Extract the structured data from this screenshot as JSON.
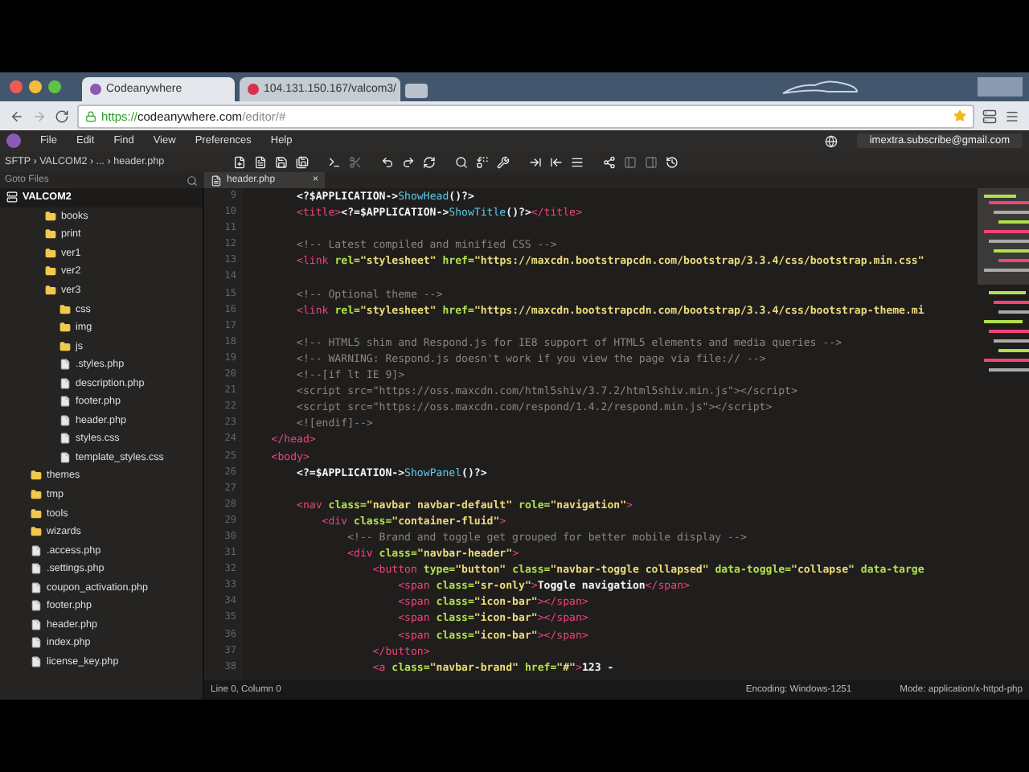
{
  "browser": {
    "tabs": [
      {
        "label": "Codeanywhere",
        "selected": true
      },
      {
        "label": "104.131.150.167/valcom3/",
        "selected": false
      }
    ],
    "address": {
      "scheme": "https://",
      "host": "codeanywhere.com",
      "path": "/editor/#"
    }
  },
  "menu": [
    "File",
    "Edit",
    "Find",
    "View",
    "Preferences",
    "Help"
  ],
  "account": "imextra.subscribe@gmail.com",
  "breadcrumb": "SFTP › VALCOM2 › ... › header.php",
  "goto_files": "Goto Files",
  "open_tab": {
    "label": "header.php",
    "close": "×"
  },
  "tree": {
    "root": "VALCOM2",
    "children": [
      {
        "kind": "folder",
        "children": [
          {
            "kind": "folder",
            "name": "books"
          },
          {
            "kind": "folder",
            "name": "print"
          },
          {
            "kind": "folder",
            "name": "ver1"
          },
          {
            "kind": "folder",
            "name": "ver2"
          },
          {
            "kind": "folder",
            "name": "ver3",
            "children": [
              {
                "kind": "folder",
                "name": "css"
              },
              {
                "kind": "folder",
                "name": "img"
              },
              {
                "kind": "folder",
                "name": "js"
              },
              {
                "kind": "file",
                "name": ".styles.php"
              },
              {
                "kind": "file",
                "name": "description.php"
              },
              {
                "kind": "file",
                "name": "footer.php"
              },
              {
                "kind": "file",
                "name": "header.php"
              },
              {
                "kind": "file",
                "name": "styles.css"
              },
              {
                "kind": "file",
                "name": "template_styles.css"
              }
            ]
          }
        ]
      },
      {
        "kind": "folder",
        "name": "themes"
      },
      {
        "kind": "folder",
        "name": "tmp"
      },
      {
        "kind": "folder",
        "name": "tools"
      },
      {
        "kind": "folder",
        "name": "wizards"
      },
      {
        "kind": "file",
        "name": ".access.php"
      },
      {
        "kind": "file",
        "name": ".settings.php"
      },
      {
        "kind": "file",
        "name": "coupon_activation.php"
      },
      {
        "kind": "file",
        "name": "footer.php"
      },
      {
        "kind": "file",
        "name": "header.php"
      },
      {
        "kind": "file",
        "name": "index.php"
      },
      {
        "kind": "file",
        "name": "license_key.php"
      }
    ]
  },
  "code": [
    {
      "n": "9",
      "tokens": [
        {
          "kind": "php",
          "text": "        <?$APPLICATION->"
        },
        {
          "kind": "method",
          "text": "ShowHead"
        },
        {
          "kind": "php",
          "text": "()?>"
        }
      ]
    },
    {
      "n": "10",
      "tokens": [
        {
          "kind": "tag",
          "text": "        <title>"
        },
        {
          "kind": "php",
          "text": "<?=$APPLICATION->"
        },
        {
          "kind": "method",
          "text": "ShowTitle"
        },
        {
          "kind": "php",
          "text": "()?>"
        },
        {
          "kind": "tag",
          "text": "</title>"
        }
      ]
    },
    {
      "n": "11"
    },
    {
      "n": "12",
      "tokens": [
        {
          "kind": "comment",
          "text": "        <!-- Latest compiled and minified CSS -->"
        }
      ]
    },
    {
      "n": "13",
      "tokens": [
        {
          "kind": "tag",
          "text": "        <link"
        },
        {
          "kind": "attr",
          "text": " rel="
        },
        {
          "kind": "string",
          "text": "\"stylesheet\""
        },
        {
          "kind": "attr",
          "text": " href="
        },
        {
          "kind": "string",
          "text": "\"https://maxcdn.bootstrapcdn.com/bootstrap/3.3.4/css/bootstrap.min.css\""
        }
      ]
    },
    {
      "n": "14"
    },
    {
      "n": "15",
      "tokens": [
        {
          "kind": "comment",
          "text": "        <!-- Optional theme -->"
        }
      ]
    },
    {
      "n": "16",
      "tokens": [
        {
          "kind": "tag",
          "text": "        <link"
        },
        {
          "kind": "attr",
          "text": " rel="
        },
        {
          "kind": "string",
          "text": "\"stylesheet\""
        },
        {
          "kind": "attr",
          "text": " href="
        },
        {
          "kind": "string",
          "text": "\"https://maxcdn.bootstrapcdn.com/bootstrap/3.3.4/css/bootstrap-theme.mi"
        }
      ]
    },
    {
      "n": "17"
    },
    {
      "n": "18",
      "tokens": [
        {
          "kind": "comment",
          "text": "        <!-- HTML5 shim and Respond.js for IE8 support of HTML5 elements and media queries -->"
        }
      ]
    },
    {
      "n": "19",
      "tokens": [
        {
          "kind": "comment",
          "text": "        <!-- WARNING: Respond.js doesn't work if you view the page via file:// -->"
        }
      ]
    },
    {
      "n": "20",
      "tokens": [
        {
          "kind": "comment",
          "text": "        <!--[if lt IE 9]>"
        }
      ]
    },
    {
      "n": "21",
      "tokens": [
        {
          "kind": "comment",
          "text": "        <script src=\"https://oss.maxcdn.com/html5shiv/3.7.2/html5shiv.min.js\"></script>"
        }
      ]
    },
    {
      "n": "22",
      "tokens": [
        {
          "kind": "comment",
          "text": "        <script src=\"https://oss.maxcdn.com/respond/1.4.2/respond.min.js\"></script>"
        }
      ]
    },
    {
      "n": "23",
      "tokens": [
        {
          "kind": "comment",
          "text": "        <![endif]-->"
        }
      ]
    },
    {
      "n": "24",
      "tokens": [
        {
          "kind": "tag",
          "text": "    </head>"
        }
      ]
    },
    {
      "n": "25",
      "tokens": [
        {
          "kind": "tag",
          "text": "    <body>"
        }
      ]
    },
    {
      "n": "26",
      "tokens": [
        {
          "kind": "php",
          "text": "        <?=$APPLICATION->"
        },
        {
          "kind": "method",
          "text": "ShowPanel"
        },
        {
          "kind": "php",
          "text": "()?>"
        }
      ]
    },
    {
      "n": "27"
    },
    {
      "n": "28",
      "tokens": [
        {
          "kind": "tag",
          "text": "        <nav"
        },
        {
          "kind": "attr",
          "text": " class="
        },
        {
          "kind": "string",
          "text": "\"navbar navbar-default\""
        },
        {
          "kind": "attr",
          "text": " role="
        },
        {
          "kind": "string",
          "text": "\"navigation\""
        },
        {
          "kind": "tag",
          "text": ">"
        }
      ]
    },
    {
      "n": "29",
      "tokens": [
        {
          "kind": "tag",
          "text": "            <div"
        },
        {
          "kind": "attr",
          "text": " class="
        },
        {
          "kind": "string",
          "text": "\"container-fluid\""
        },
        {
          "kind": "tag",
          "text": ">"
        }
      ]
    },
    {
      "n": "30",
      "tokens": [
        {
          "kind": "comment",
          "text": "                <!-- Brand and toggle get grouped for better mobile display -->"
        }
      ]
    },
    {
      "n": "31",
      "tokens": [
        {
          "kind": "tag",
          "text": "                <div"
        },
        {
          "kind": "attr",
          "text": " class="
        },
        {
          "kind": "string",
          "text": "\"navbar-header\""
        },
        {
          "kind": "tag",
          "text": ">"
        }
      ]
    },
    {
      "n": "32",
      "tokens": [
        {
          "kind": "tag",
          "text": "                    <button"
        },
        {
          "kind": "attr",
          "text": " type="
        },
        {
          "kind": "string",
          "text": "\"button\""
        },
        {
          "kind": "attr",
          "text": " class="
        },
        {
          "kind": "string",
          "text": "\"navbar-toggle collapsed\""
        },
        {
          "kind": "attr",
          "text": " data-toggle="
        },
        {
          "kind": "string",
          "text": "\"collapse\""
        },
        {
          "kind": "attr",
          "text": " data-targe"
        }
      ]
    },
    {
      "n": "33",
      "tokens": [
        {
          "kind": "tag",
          "text": "                        <span"
        },
        {
          "kind": "attr",
          "text": " class="
        },
        {
          "kind": "string",
          "text": "\"sr-only\""
        },
        {
          "kind": "tag",
          "text": ">"
        },
        {
          "kind": "text",
          "text": "Toggle navigation"
        },
        {
          "kind": "tag",
          "text": "</span>"
        }
      ]
    },
    {
      "n": "34",
      "tokens": [
        {
          "kind": "tag",
          "text": "                        <span"
        },
        {
          "kind": "attr",
          "text": " class="
        },
        {
          "kind": "string",
          "text": "\"icon-bar\""
        },
        {
          "kind": "tag",
          "text": "></span>"
        }
      ]
    },
    {
      "n": "35",
      "tokens": [
        {
          "kind": "tag",
          "text": "                        <span"
        },
        {
          "kind": "attr",
          "text": " class="
        },
        {
          "kind": "string",
          "text": "\"icon-bar\""
        },
        {
          "kind": "tag",
          "text": "></span>"
        }
      ]
    },
    {
      "n": "36",
      "tokens": [
        {
          "kind": "tag",
          "text": "                        <span"
        },
        {
          "kind": "attr",
          "text": " class="
        },
        {
          "kind": "string",
          "text": "\"icon-bar\""
        },
        {
          "kind": "tag",
          "text": "></span>"
        }
      ]
    },
    {
      "n": "37",
      "tokens": [
        {
          "kind": "tag",
          "text": "                    </button>"
        }
      ]
    },
    {
      "n": "38",
      "tokens": [
        {
          "kind": "tag",
          "text": "                    <a"
        },
        {
          "kind": "attr",
          "text": " class="
        },
        {
          "kind": "string",
          "text": "\"navbar-brand\""
        },
        {
          "kind": "attr",
          "text": " href="
        },
        {
          "kind": "string",
          "text": "\"#\""
        },
        {
          "kind": "tag",
          "text": ">"
        },
        {
          "kind": "text",
          "text": "123 -"
        }
      ]
    }
  ],
  "status": {
    "position": "Line 0, Column 0",
    "encoding": "Encoding: Windows-1251",
    "mode": "Mode: application/x-httpd-php"
  }
}
